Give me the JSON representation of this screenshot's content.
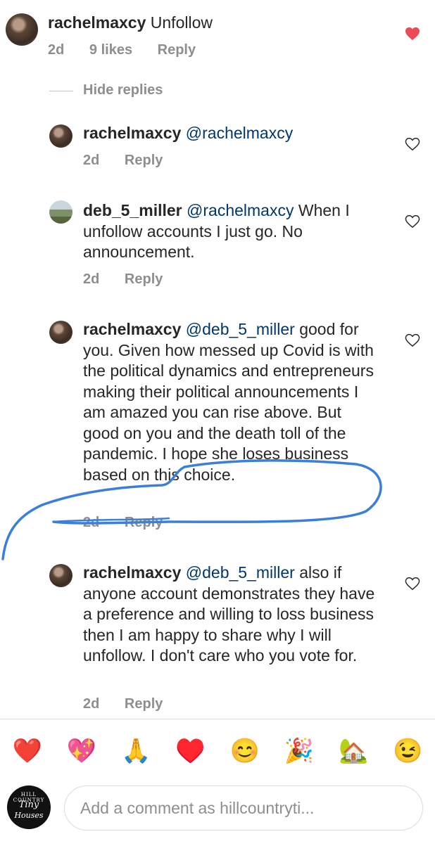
{
  "top_comment": {
    "username": "rachelmaxcy",
    "text": "Unfollow",
    "time": "2d",
    "likes": "9 likes",
    "reply_label": "Reply",
    "liked": true
  },
  "hide_replies_label": "Hide replies",
  "replies": [
    {
      "username": "rachelmaxcy",
      "mention": "@rachelmaxcy",
      "text": "",
      "time": "2d",
      "reply_label": "Reply"
    },
    {
      "username": "deb_5_miller",
      "mention": "@rachelmaxcy",
      "text": " When I unfollow accounts I just go.  No announcement.",
      "time": "2d",
      "reply_label": "Reply"
    },
    {
      "username": "rachelmaxcy",
      "mention": "@deb_5_miller",
      "text": " good for you. Given how messed up Covid is with the political dynamics and entrepreneurs making their political announcements I am amazed you can rise above. But good on you and the death toll of the pandemic. I hope she loses business based on this choice.",
      "time": "2d",
      "reply_label": "Reply"
    },
    {
      "username": "rachelmaxcy",
      "mention": "@deb_5_miller",
      "text": " also if anyone account demonstrates they have a preference and willing to loss business then I am happy to share why I will unfollow. I don't care who you vote for.",
      "time": "2d",
      "reply_label": "Reply"
    }
  ],
  "emoji_bar": [
    "❤️",
    "💖",
    "🙏",
    "♥️",
    "😊",
    "🎉",
    "🏡",
    "😉"
  ],
  "logo": {
    "line1": "HILL COUNTRY",
    "line2": "Tiny",
    "line3": "Houses"
  },
  "comment_input": {
    "placeholder": "Add a comment as hillcountryti..."
  },
  "colors": {
    "like_red": "#ed4956",
    "mention_blue": "#00376b",
    "muted_gray": "#8e8e8e",
    "scribble_blue": "#3b7fd9"
  }
}
